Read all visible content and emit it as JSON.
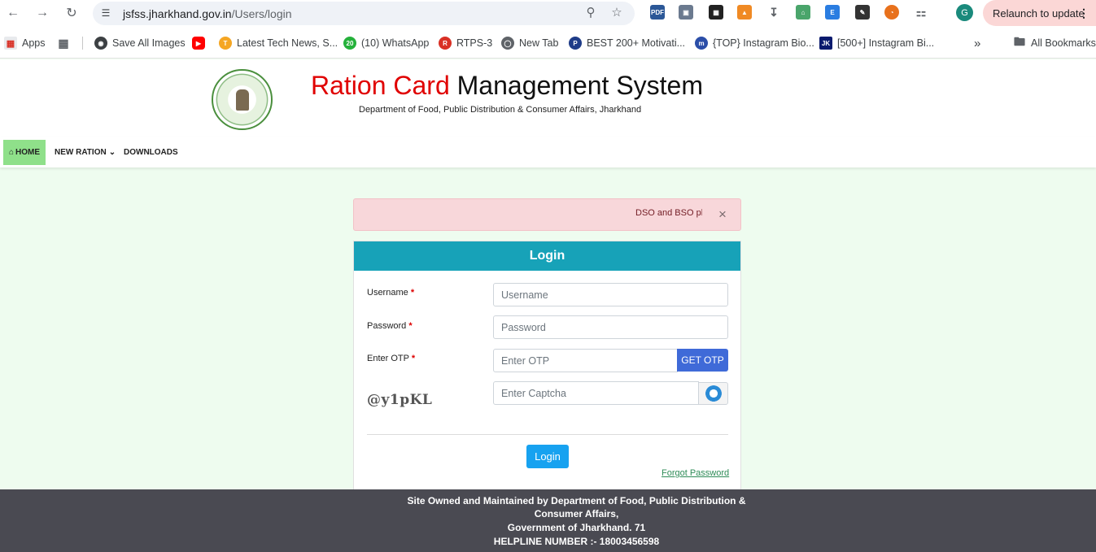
{
  "browser": {
    "url_host": "jsfss.jharkhand.gov.in",
    "url_path": "/Users/login",
    "profile_initial": "G",
    "relaunch_label": "Relaunch to update",
    "bookmarks": [
      {
        "label": "Apps",
        "icon": "apps-grid-icon"
      },
      {
        "label": "Save All Images",
        "icon": "save-images-icon"
      },
      {
        "label": "",
        "icon": "youtube-icon"
      },
      {
        "label": "Latest Tech News, S...",
        "icon": "tech-news-icon"
      },
      {
        "label": "(10) WhatsApp",
        "icon": "whatsapp-icon",
        "badge": "20"
      },
      {
        "label": "RTPS-3",
        "icon": "rtps-icon"
      },
      {
        "label": "New Tab",
        "icon": "chrome-icon"
      },
      {
        "label": "BEST 200+ Motivati...",
        "icon": "motivation-icon",
        "badge": "P"
      },
      {
        "label": "{TOP} Instagram Bio...",
        "icon": "instagram-bio-icon"
      },
      {
        "label": "[500+] Instagram Bi...",
        "icon": "jk-icon",
        "badge": "JK"
      },
      {
        "label": "All Bookmarks",
        "icon": "folder-icon"
      }
    ]
  },
  "header": {
    "title_red": "Ration Card",
    "title_black": "Management System",
    "subtitle": "Department of Food, Public Distribution & Consumer Affairs, Jharkhand"
  },
  "nav": {
    "home": "HOME",
    "new_ration": "NEW RATION",
    "downloads": "DOWNLOADS"
  },
  "alert": {
    "message": "DSO and BSO ple",
    "close": "×"
  },
  "login": {
    "title": "Login",
    "username_label": "Username",
    "username_placeholder": "Username",
    "password_label": "Password",
    "password_placeholder": "Password",
    "otp_label": "Enter OTP",
    "otp_placeholder": "Enter OTP",
    "get_otp": "GET OTP",
    "captcha_text": "@y1pKL",
    "captcha_placeholder": "Enter Captcha",
    "required_mark": "*",
    "submit": "Login",
    "forgot": "Forgot Password"
  },
  "footer": {
    "line1": "Site Owned and Maintained by Department of Food, Public Distribution &",
    "line2": "Consumer Affairs,",
    "line3": "Government of Jharkhand. 71",
    "line4": "HELPLINE NUMBER :- 18003456598"
  },
  "colors": {
    "accent_teal": "#17a2b8",
    "title_red": "#e00000",
    "page_bg": "#eefcef",
    "footer_bg": "#4a4a52",
    "nav_active": "#8fe08a"
  }
}
